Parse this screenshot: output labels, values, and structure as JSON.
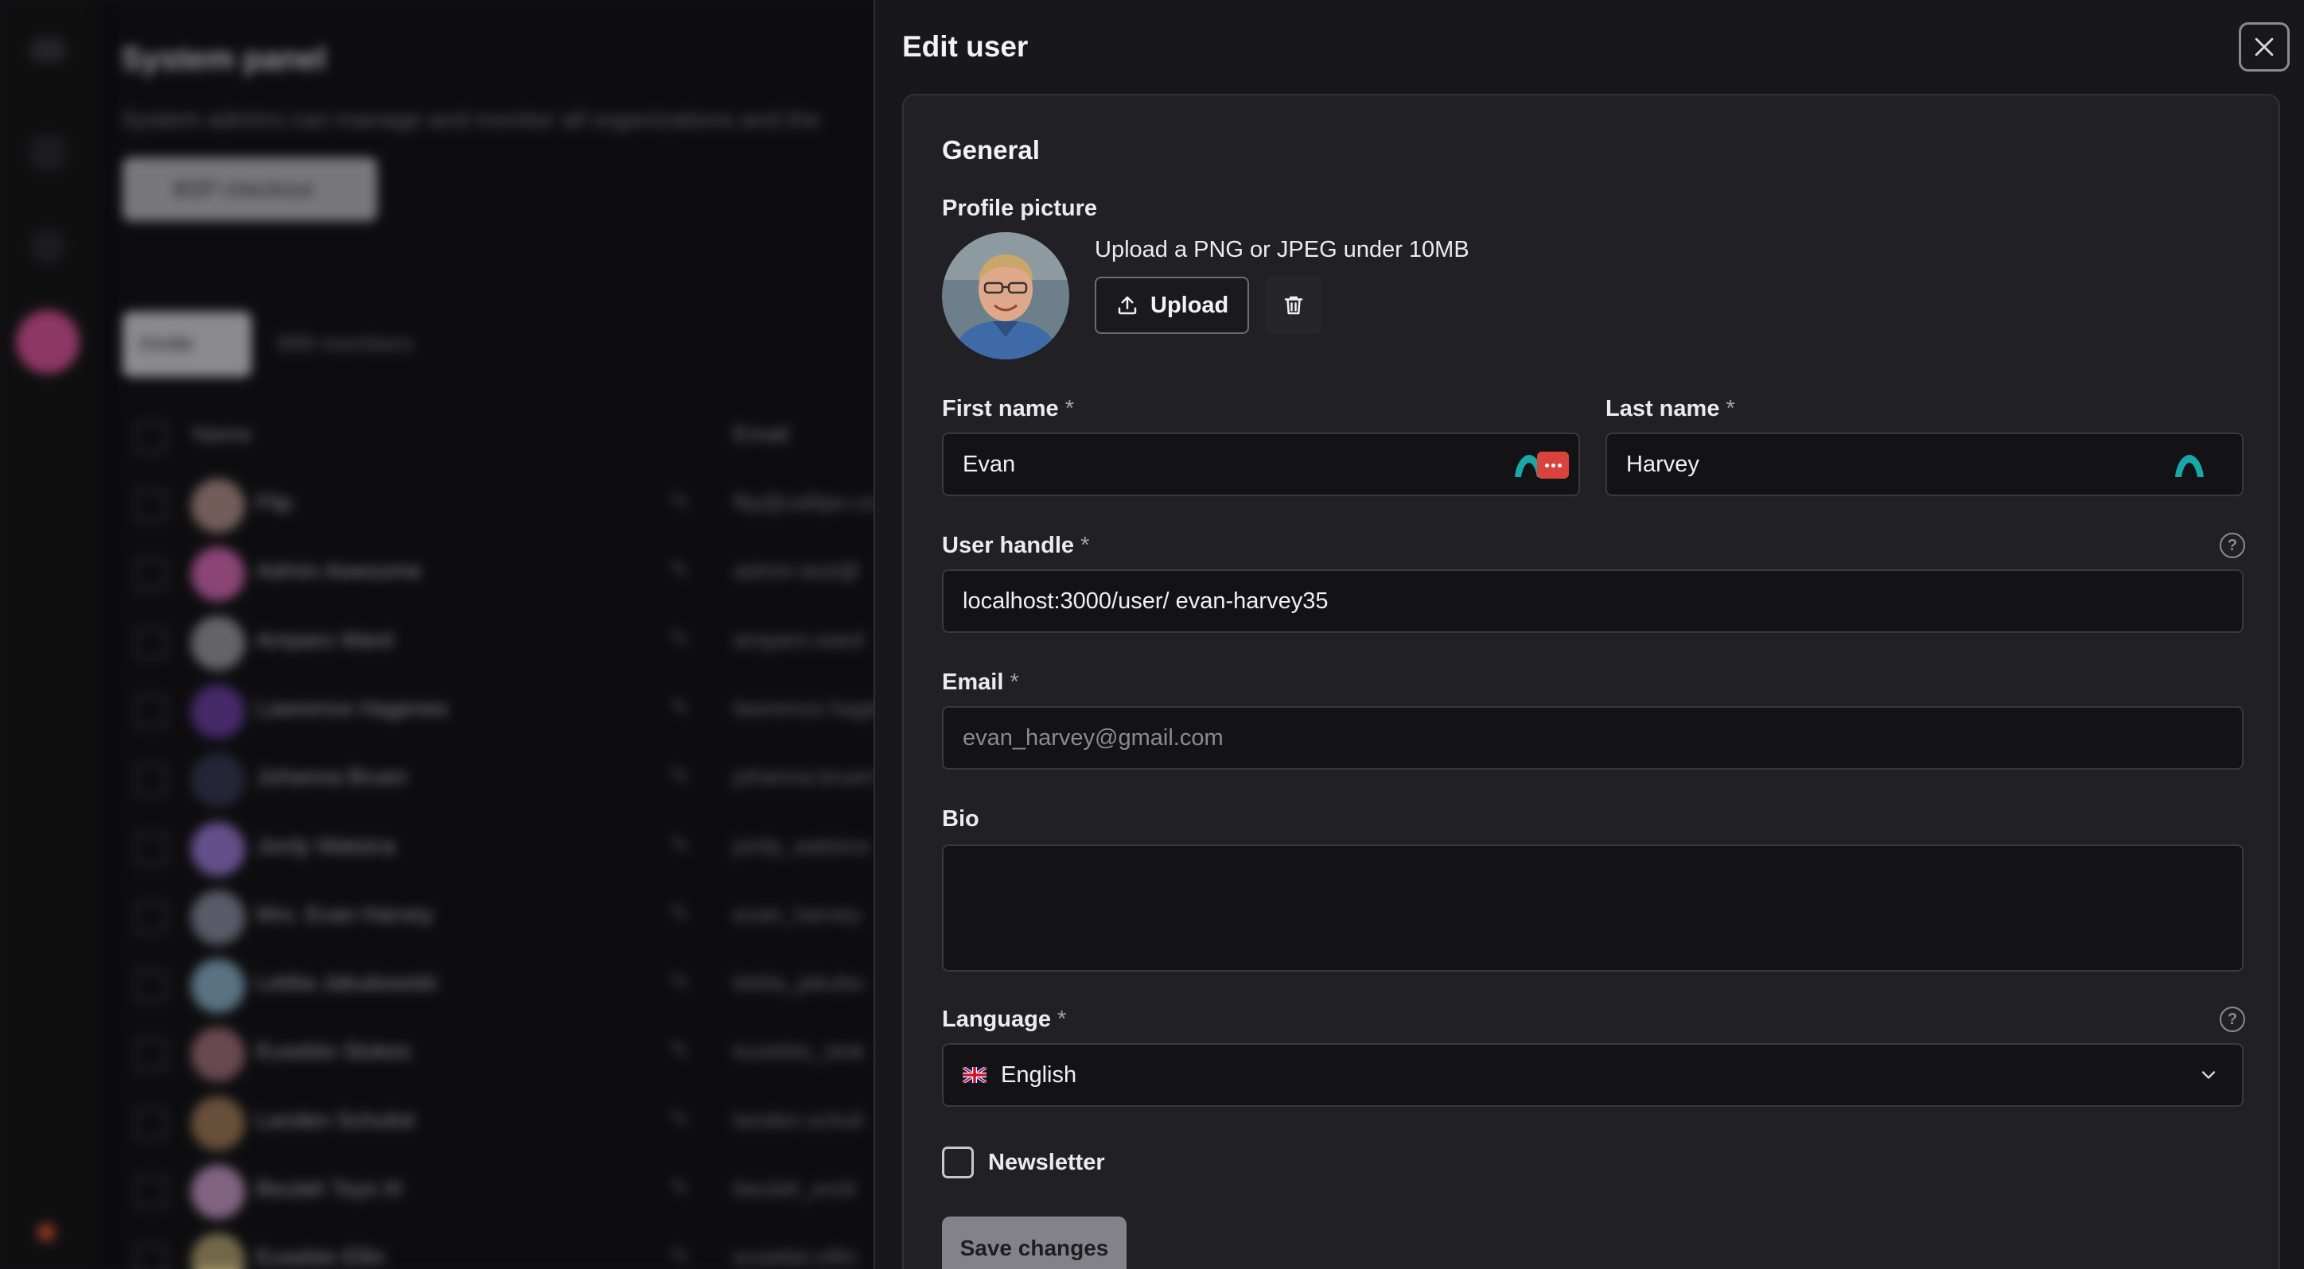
{
  "background": {
    "title": "System panel",
    "subtitle": "System admins can manage and monitor all organizations and the",
    "primary_button": "BSP checkout",
    "invite_button": "Invite",
    "members_count": "999 members",
    "columns": {
      "name": "Name",
      "email": "Email"
    },
    "rows": [
      {
        "name": "Flip",
        "email": "flip@cellipo.co",
        "avatar_color": "#b0908a"
      },
      {
        "name": "Admin Awesome",
        "email": "admin-test@",
        "avatar_color": "#d46ab6"
      },
      {
        "name": "Amparo Ward",
        "email": "amparo.ward",
        "avatar_color": "#9a9aa0"
      },
      {
        "name": "Lawrence Hagenes",
        "email": "lawrence.hage",
        "avatar_color": "#6a3fa0"
      },
      {
        "name": "Johanna Bruen",
        "email": "johanna.bruen",
        "avatar_color": "#3a3a55"
      },
      {
        "name": "Jordy Watsica",
        "email": "jordy_watsica",
        "avatar_color": "#9a7ad4"
      },
      {
        "name": "Mrs. Evan Harvey",
        "email": "evan_harvey",
        "avatar_color": "#8a8aa0"
      },
      {
        "name": "Letitia Jakubowski",
        "email": "letitia_jakubo",
        "avatar_color": "#8ab0c8"
      },
      {
        "name": "Eusebio Stokes",
        "email": "eusebio_stok",
        "avatar_color": "#a0707a"
      },
      {
        "name": "Landen Schulist",
        "email": "landen.schuli",
        "avatar_color": "#a07a5a"
      },
      {
        "name": "Beulah Toys III",
        "email": "beulah_eroti",
        "avatar_color": "#c89ac8"
      },
      {
        "name": "Eusebio Ellin",
        "email": "eusebio.ellin",
        "avatar_color": "#b0a070"
      }
    ]
  },
  "panel": {
    "title": "Edit user",
    "section_title": "General",
    "profile_picture_label": "Profile picture",
    "upload_hint": "Upload a PNG or JPEG under 10MB",
    "upload_label": "Upload",
    "first_name_label": "First name",
    "first_name_value": "Evan",
    "last_name_label": "Last name",
    "last_name_value": "Harvey",
    "handle_label": "User handle",
    "handle_prefix": "localhost:3000/user/",
    "handle_value": "evan-harvey35",
    "email_label": "Email",
    "email_value": "evan_harvey@gmail.com",
    "bio_label": "Bio",
    "bio_value": "",
    "language_label": "Language",
    "language_value": "English",
    "language_flag": "🇬🇧",
    "newsletter_label": "Newsletter",
    "newsletter_checked": false,
    "save_label": "Save changes",
    "required_mark": "*",
    "help_glyph": "?"
  },
  "colors": {
    "accent_teal": "#1aa7a8",
    "password_manager_red": "#d8433b",
    "save_button": "#828288"
  }
}
